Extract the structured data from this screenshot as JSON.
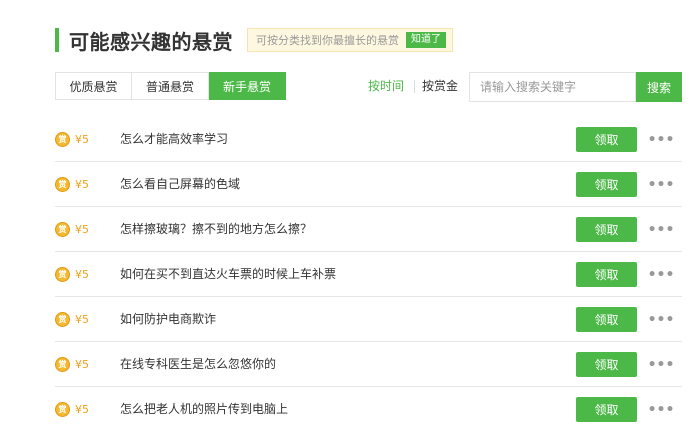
{
  "header": {
    "title": "可能感兴趣的悬赏",
    "tip_text": "可按分类找到你最擅长的悬赏",
    "tip_button": "知道了"
  },
  "tabs": [
    {
      "label": "优质悬赏",
      "active": false
    },
    {
      "label": "普通悬赏",
      "active": false
    },
    {
      "label": "新手悬赏",
      "active": true
    }
  ],
  "sort": {
    "by_time": "按时间",
    "by_bounty": "按赏金"
  },
  "search": {
    "placeholder": "请输入搜索关键字",
    "button_label": "搜索"
  },
  "coin_glyph": "赏",
  "claim_label": "领取",
  "more_label": "•••",
  "questions": [
    {
      "reward": "¥5",
      "title": "怎么才能高效率学习"
    },
    {
      "reward": "¥5",
      "title": "怎么看自己屏幕的色域"
    },
    {
      "reward": "¥5",
      "title": "怎样擦玻璃？擦不到的地方怎么擦？"
    },
    {
      "reward": "¥5",
      "title": "如何在买不到直达火车票的时候上车补票"
    },
    {
      "reward": "¥5",
      "title": "如何防护电商欺诈"
    },
    {
      "reward": "¥5",
      "title": "在线专科医生是怎么忽悠你的"
    },
    {
      "reward": "¥5",
      "title": "怎么把老人机的照片传到电脑上"
    }
  ],
  "colors": {
    "accent": "#4cb848",
    "coin": "#f5b82e",
    "reward_text": "#f0a01e"
  }
}
